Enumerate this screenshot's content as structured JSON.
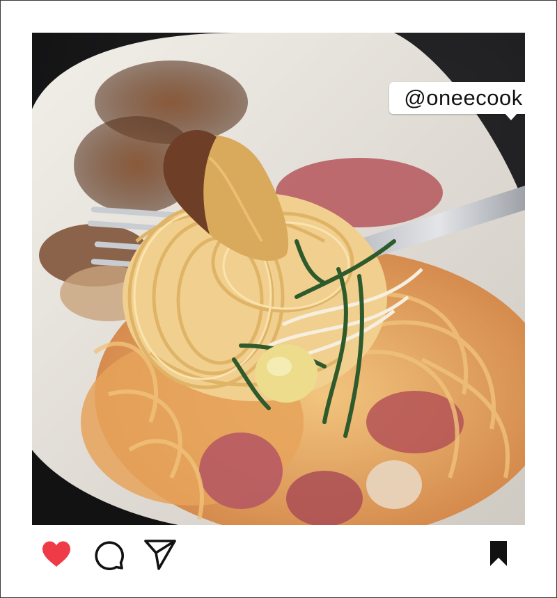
{
  "post": {
    "tag_handle": "@oneecook",
    "photo_icon": "food-photo-spaghetti-fork",
    "accent_colors": {
      "liked": "#ef3b47",
      "icon": "#111111"
    }
  },
  "actions": [
    {
      "name": "like-heart-icon",
      "state": "liked"
    },
    {
      "name": "comment-bubble-icon"
    },
    {
      "name": "share-paper-plane-icon"
    },
    {
      "name": "save-bookmark-icon",
      "state": "saved"
    }
  ]
}
